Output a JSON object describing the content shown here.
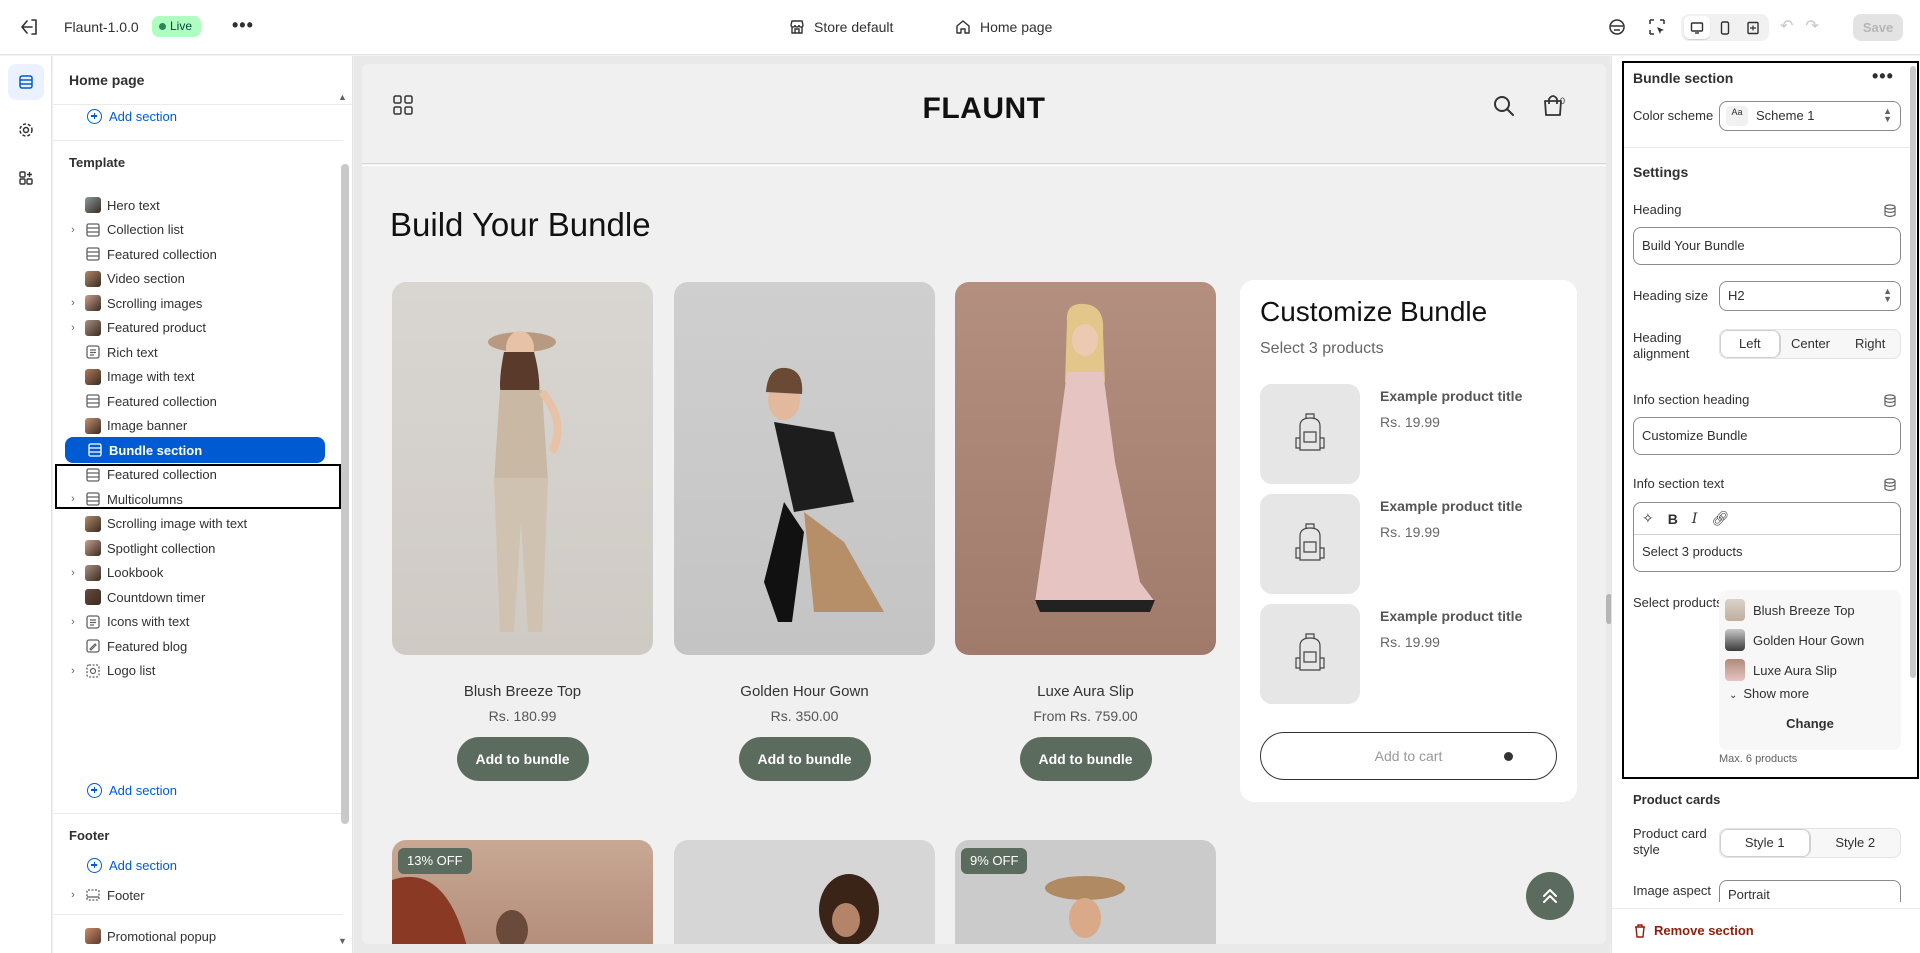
{
  "topbar": {
    "app_name": "Flaunt-1.0.0",
    "status": "Live",
    "more": "•••",
    "store_label": "Store default",
    "page_label": "Home page",
    "save_label": "Save"
  },
  "sidebar": {
    "title": "Home page",
    "add_section": "Add section",
    "template_label": "Template",
    "template_items": [
      {
        "label": "Hero text",
        "expandable": false
      },
      {
        "label": "Collection list",
        "expandable": true
      },
      {
        "label": "Featured collection",
        "expandable": false
      },
      {
        "label": "Video section",
        "expandable": false
      },
      {
        "label": "Scrolling images",
        "expandable": true
      },
      {
        "label": "Featured product",
        "expandable": true
      },
      {
        "label": "Rich text",
        "expandable": false
      },
      {
        "label": "Image with text",
        "expandable": false
      },
      {
        "label": "Featured collection",
        "expandable": false
      },
      {
        "label": "Image banner",
        "expandable": false
      },
      {
        "label": "Bundle section",
        "expandable": false,
        "selected": true
      },
      {
        "label": "Featured collection",
        "expandable": false
      },
      {
        "label": "Multicolumns",
        "expandable": true
      },
      {
        "label": "Scrolling image with text",
        "expandable": false
      },
      {
        "label": "Spotlight collection",
        "expandable": false
      },
      {
        "label": "Lookbook",
        "expandable": true
      },
      {
        "label": "Countdown timer",
        "expandable": false
      },
      {
        "label": "Icons with text",
        "expandable": true
      },
      {
        "label": "Featured blog",
        "expandable": false
      },
      {
        "label": "Logo list",
        "expandable": true
      }
    ],
    "footer_label": "Footer",
    "footer_item": "Footer",
    "popup_item": "Promotional popup"
  },
  "preview": {
    "logo": "FLAUNT",
    "cart_count": "0",
    "heading": "Build Your Bundle",
    "products": [
      {
        "name": "Blush Breeze Top",
        "price": "Rs. 180.99",
        "button": "Add to bundle"
      },
      {
        "name": "Golden Hour Gown",
        "price": "Rs. 350.00",
        "button": "Add to bundle"
      },
      {
        "name": "Luxe Aura Slip",
        "price": "From Rs. 759.00",
        "button": "Add to bundle"
      }
    ],
    "bundle": {
      "title": "Customize Bundle",
      "subtitle": "Select 3 products",
      "slot_title": "Example product title",
      "slot_price": "Rs. 19.99",
      "cart_label": "Add to cart"
    },
    "discounts": [
      "13% OFF",
      "9% OFF"
    ]
  },
  "settings": {
    "title": "Bundle section",
    "color_scheme_label": "Color scheme",
    "color_scheme_value": "Scheme 1",
    "color_scheme_swatch": "Aa",
    "settings_label": "Settings",
    "heading_label": "Heading",
    "heading_value": "Build Your Bundle",
    "heading_size_label": "Heading size",
    "heading_size_value": "H2",
    "heading_alignment_label": "Heading alignment",
    "alignment_options": [
      "Left",
      "Center",
      "Right"
    ],
    "info_heading_label": "Info section heading",
    "info_heading_value": "Customize Bundle",
    "info_text_label": "Info section text",
    "info_text_value": "Select 3 products",
    "select_products_label": "Select products",
    "selected_products": [
      "Blush Breeze Top",
      "Golden Hour Gown",
      "Luxe Aura Slip"
    ],
    "show_more": "Show more",
    "change": "Change",
    "max_note": "Max. 6 products",
    "product_cards_label": "Product cards",
    "card_style_label": "Product card style",
    "card_style_options": [
      "Style 1",
      "Style 2"
    ],
    "aspect_label": "Image aspect ratio",
    "aspect_value": "Portrait",
    "remove_label": "Remove section"
  },
  "colors": {
    "accent": "#005bd3",
    "button_green": "#5b6b5d",
    "danger": "#8e1f0b"
  }
}
